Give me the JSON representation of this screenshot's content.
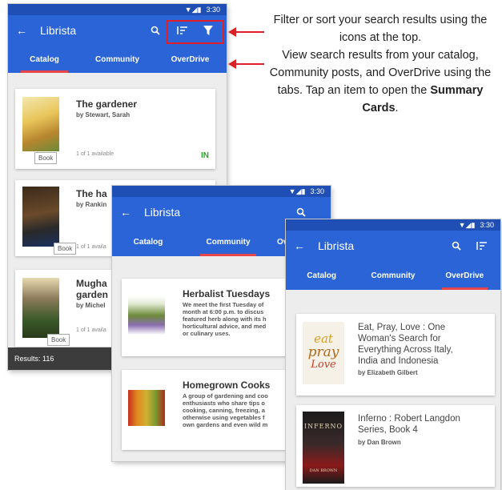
{
  "annotation": {
    "line1": "Filter or sort your search results using the icons at the top.",
    "line2a": "View search results from your catalog, Community posts, and OverDrive using the tabs. Tap an item to open the ",
    "line2b": "Summary Cards",
    "line2c": "."
  },
  "status_time": "3:30",
  "app_title": "Librista",
  "tabs": [
    "Catalog",
    "Community",
    "OverDrive"
  ],
  "screen1": {
    "items": [
      {
        "title": "The gardener",
        "author": "by Stewart, Sarah",
        "avail": "1 of 1 available",
        "badge": "Book",
        "status": "IN"
      },
      {
        "title": "The ha",
        "author": "by Rankin",
        "avail": "1 of 1 availa",
        "badge": "Book"
      },
      {
        "title_l1": "Mugha",
        "title_l2": "garden",
        "author": "by Michel",
        "avail": "1 of 1 availa",
        "badge": "Book"
      }
    ],
    "results": "Results: 116"
  },
  "screen2": {
    "tab2_partial": "Ov",
    "items": [
      {
        "title": "Herbalist Tuesdays",
        "desc": [
          "We meet the first Tuesday of",
          "month at 6:00 p.m. to discus",
          "featured herb along with its h",
          "horticultural advice, and med",
          "or culinary uses."
        ]
      },
      {
        "title": "Homegrown Cooks",
        "desc": [
          "A group of gardening and coo",
          "enthusiasts who share tips o",
          "cooking, canning, freezing, a",
          "otherwise using vegetables f",
          "own gardens and even wild m"
        ]
      }
    ]
  },
  "screen3": {
    "items": [
      {
        "title": [
          "Eat, Pray, Love : One",
          "Woman's Search for",
          "Everything Across Italy,",
          "India and Indonesia"
        ],
        "author": "by Elizabeth Gilbert",
        "cover_text": [
          "eat",
          "pray",
          "Love"
        ]
      },
      {
        "title": [
          "Inferno : Robert Langdon",
          "Series, Book 4"
        ],
        "author": "by Dan Brown",
        "cover_text": [
          "INFERNO",
          "DAN BROWN"
        ]
      }
    ]
  },
  "colors": {
    "primary": "#2a64d6",
    "status_bar": "#1f4fb5",
    "accent": "#e8454b",
    "available": "#2ca02c",
    "highlight": "#e01f26"
  }
}
